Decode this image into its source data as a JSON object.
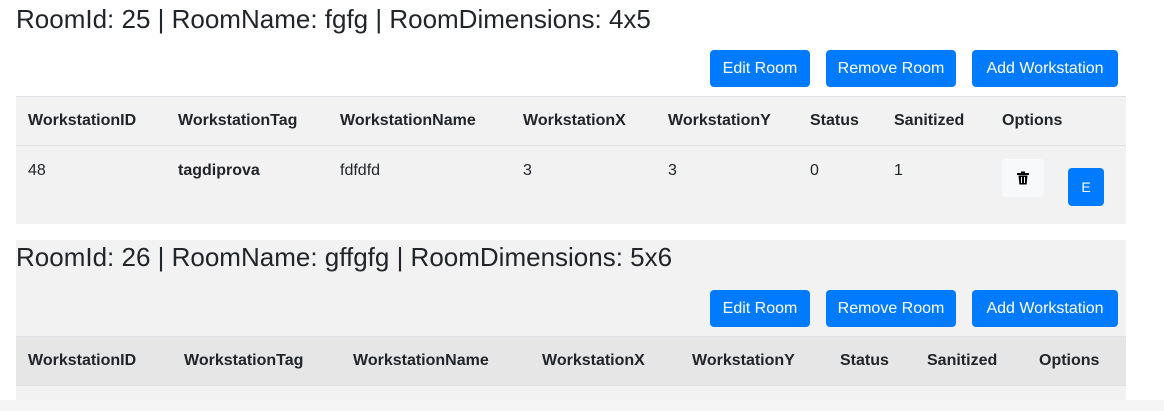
{
  "rooms": [
    {
      "title": "RoomId: 25 | RoomName: fgfg | RoomDimensions: 4x5",
      "edit_label": "Edit Room",
      "remove_label": "Remove Room",
      "add_label": "Add Workstation",
      "columns": [
        "WorkstationID",
        "WorkstationTag",
        "WorkstationName",
        "WorkstationX",
        "WorkstationY",
        "Status",
        "Sanitized",
        "Options"
      ],
      "rows": [
        {
          "id": "48",
          "tag": "tagdiprova",
          "name": "fdfdfd",
          "x": "3",
          "y": "3",
          "status": "0",
          "sanitized": "1",
          "edit_short": "E",
          "delete_icon": "trash-icon"
        }
      ]
    },
    {
      "title": "RoomId: 26 | RoomName: gffgfg | RoomDimensions: 5x6",
      "edit_label": "Edit Room",
      "remove_label": "Remove Room",
      "add_label": "Add Workstation",
      "columns": [
        "WorkstationID",
        "WorkstationTag",
        "WorkstationName",
        "WorkstationX",
        "WorkstationY",
        "Status",
        "Sanitized",
        "Options"
      ],
      "rows": []
    }
  ],
  "colors": {
    "primary": "#007bff",
    "panel": "#f2f2f2",
    "text": "#212529"
  }
}
